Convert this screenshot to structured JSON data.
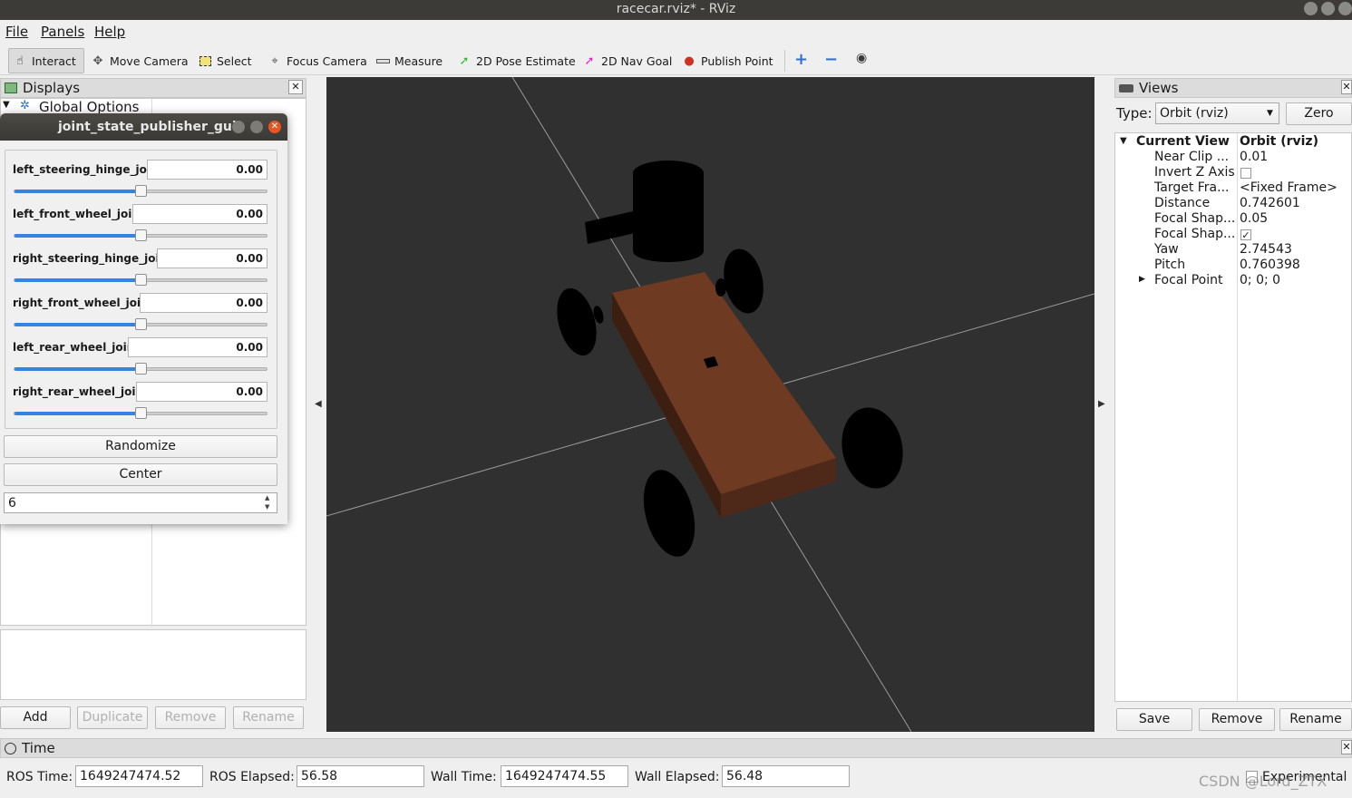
{
  "window_title": "racecar.rviz* - RViz",
  "menu": [
    "File",
    "Panels",
    "Help"
  ],
  "toolbar": {
    "tools": [
      {
        "label": "Interact",
        "icon": "hand-icon",
        "color": "#333333"
      },
      {
        "label": "Move Camera",
        "icon": "move-camera-icon",
        "color": "#555555"
      },
      {
        "label": "Select",
        "icon": "select-icon",
        "color": "#d4b000"
      },
      {
        "label": "Focus Camera",
        "icon": "focus-camera-icon",
        "color": "#555555"
      },
      {
        "label": "Measure",
        "icon": "ruler-icon",
        "color": "#555555"
      },
      {
        "label": "2D Pose Estimate",
        "icon": "green-arrow-icon",
        "color": "#2eb82e"
      },
      {
        "label": "2D Nav Goal",
        "icon": "pink-arrow-icon",
        "color": "#e020c8"
      },
      {
        "label": "Publish Point",
        "icon": "map-pin-icon",
        "color": "#d03020"
      }
    ]
  },
  "displays": {
    "title": "Displays",
    "global_options": "Global Options",
    "buttons": {
      "add": "Add",
      "duplicate": "Duplicate",
      "remove": "Remove",
      "rename": "Rename"
    }
  },
  "jsp": {
    "title": "joint_state_publisher_gui",
    "joints": [
      {
        "name": "left_steering_hinge_joint",
        "value": "0.00",
        "fraction": 0.5
      },
      {
        "name": "left_front_wheel_joint",
        "value": "0.00",
        "fraction": 0.5
      },
      {
        "name": "right_steering_hinge_joint",
        "value": "0.00",
        "fraction": 0.5
      },
      {
        "name": "right_front_wheel_joint",
        "value": "0.00",
        "fraction": 0.5
      },
      {
        "name": "left_rear_wheel_joint",
        "value": "0.00",
        "fraction": 0.5
      },
      {
        "name": "right_rear_wheel_joint",
        "value": "0.00",
        "fraction": 0.5
      }
    ],
    "randomize": "Randomize",
    "center": "Center",
    "spin_value": "6"
  },
  "views": {
    "title": "Views",
    "type_label": "Type:",
    "type_value": "Orbit (rviz)",
    "zero": "Zero",
    "current_view": "Current View",
    "current_view_value": "Orbit (rviz)",
    "props": [
      {
        "name": "Near Clip ...",
        "value": "0.01"
      },
      {
        "name": "Invert Z Axis",
        "value": "",
        "checkbox": false
      },
      {
        "name": "Target Fra...",
        "value": "<Fixed Frame>"
      },
      {
        "name": "Distance",
        "value": "0.742601"
      },
      {
        "name": "Focal Shap...",
        "value": "0.05"
      },
      {
        "name": "Focal Shap...",
        "value": "",
        "checkbox": true
      },
      {
        "name": "Yaw",
        "value": "2.74543"
      },
      {
        "name": "Pitch",
        "value": "0.760398"
      },
      {
        "name": "Focal Point",
        "value": "0; 0; 0"
      }
    ],
    "buttons": {
      "save": "Save",
      "remove": "Remove",
      "rename": "Rename"
    }
  },
  "time": {
    "title": "Time",
    "ros_time_label": "ROS Time:",
    "ros_time": "1649247474.52",
    "ros_elapsed_label": "ROS Elapsed:",
    "ros_elapsed": "56.58",
    "wall_time_label": "Wall Time:",
    "wall_time": "1649247474.55",
    "wall_elapsed_label": "Wall Elapsed:",
    "wall_elapsed": "56.48",
    "experimental": "Experimental"
  },
  "watermark": "CSDN @Lord_ZTX",
  "colors": {
    "chassis": "#6e3a22",
    "wheel": "#000000",
    "viewport_bg": "#303030",
    "slider_fill": "#3584e4"
  }
}
